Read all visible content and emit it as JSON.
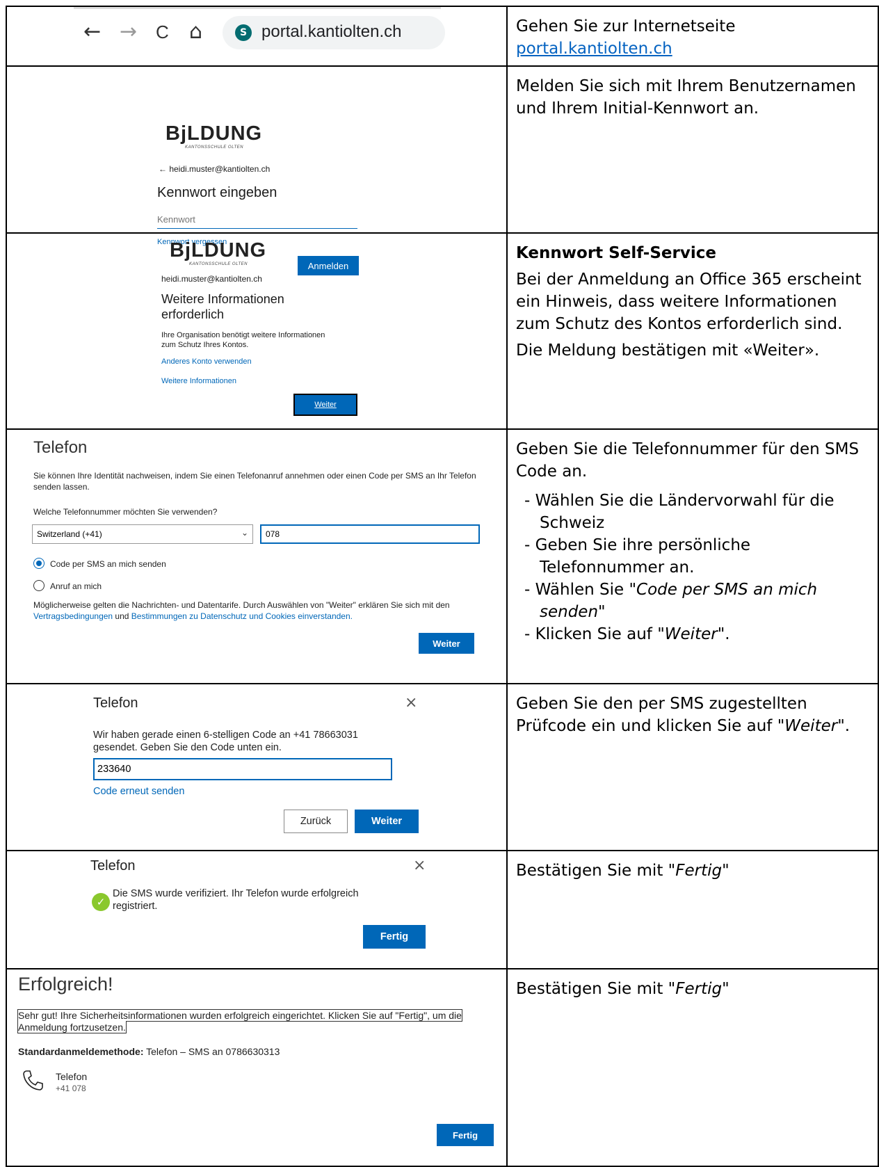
{
  "browser": {
    "back": "←",
    "forward": "→",
    "reload": "C",
    "home": "⌂",
    "site_icon": "S",
    "url": "portal.kantiolten.ch"
  },
  "instructions": {
    "step1": {
      "text": "Gehen Sie zur Internetseite",
      "link": "portal.kantiolten.ch"
    },
    "step2": "Melden Sie sich mit Ihrem Benutzernamen und Ihrem Initial-Kennwort an.",
    "step3": {
      "heading": "Kennwort Self-Service",
      "p1": "Bei der Anmeldung an Office 365 erscheint ein Hinweis, dass weitere Informationen zum Schutz des Kontos erforderlich sind.",
      "p2": "Die Meldung bestätigen mit «Weiter»."
    },
    "step4": {
      "intro": "Geben Sie die Telefonnummer für den SMS Code an.",
      "b1": "Wählen Sie die Ländervorwahl für die Schweiz",
      "b2": "Geben Sie ihre persönliche Telefonnummer an.",
      "b3_pre": "Wählen Sie \"",
      "b3_em": "Code per SMS an mich senden",
      "b3_post": "\"",
      "b4_pre": "Klicken Sie auf \"",
      "b4_em": "Weiter",
      "b4_post": "\"."
    },
    "step5": {
      "pre": "Geben Sie den per SMS zugestellten Prüfcode ein und klicken Sie auf ",
      "q1": "\"",
      "em": "Weiter",
      "post": "\"."
    },
    "step6": {
      "pre": "Bestätigen Sie mit \"",
      "em": "Fertig",
      "post": "\""
    },
    "step7": {
      "pre": "Bestätigen Sie mit \"",
      "em": "Fertig",
      "post": "\""
    }
  },
  "login": {
    "logo": "BjLDUNG",
    "logo_sub": "KANTONSSCHULE OLTEN",
    "back_email": "← heidi.muster@kantiolten.ch",
    "title": "Kennwort eingeben",
    "password_placeholder": "Kennwort",
    "forgot": "Kennwort vergessen",
    "signin": "Anmelden"
  },
  "more_info": {
    "logo": "BjLDUNG",
    "logo_sub": "KANTONSSCHULE OLTEN",
    "email": "heidi.muster@kantiolten.ch",
    "title_l1": "Weitere Informationen",
    "title_l2": "erforderlich",
    "desc_l1": "Ihre Organisation benötigt weitere Informationen",
    "desc_l2": "zum Schutz Ihres Kontos.",
    "other_account": "Anderes Konto verwenden",
    "more_link": "Weitere Informationen",
    "next": "Weiter"
  },
  "phone_setup": {
    "title": "Telefon",
    "desc": "Sie können Ihre Identität nachweisen, indem Sie einen Telefonanruf annehmen oder einen Code per SMS an Ihr Telefon senden lassen.",
    "question": "Welche Telefonnummer möchten Sie verwenden?",
    "country": "Switzerland (+41)",
    "phone_value": "078",
    "opt_sms": "Code per SMS an mich senden",
    "opt_call": "Anruf an mich",
    "terms_pre": "Möglicherweise gelten die Nachrichten- und Datentarife. Durch Auswählen von \"Weiter\" erklären Sie sich mit den ",
    "terms_link1": "Vertragsbedingungen",
    "terms_mid": " und ",
    "terms_link2": "Bestimmungen zu Datenschutz und Cookies einverstanden.",
    "next": "Weiter"
  },
  "code_dialog": {
    "title": "Telefon",
    "close": "×",
    "msg_l1": "Wir haben gerade einen 6-stelligen Code an +41 78663031",
    "msg_l2": "gesendet. Geben Sie den Code unten ein.",
    "code_value": "233640",
    "resend": "Code erneut senden",
    "back": "Zurück",
    "next": "Weiter"
  },
  "verified_dialog": {
    "title": "Telefon",
    "close": "×",
    "check": "✓",
    "msg_l1": "Die SMS wurde verifiziert. Ihr Telefon wurde erfolgreich",
    "msg_l2": "registriert.",
    "done": "Fertig"
  },
  "success": {
    "title": "Erfolgreich!",
    "msg": "Sehr gut! Ihre Sicherheitsinformationen wurden erfolgreich eingerichtet. Klicken Sie auf \"Fertig\", um die Anmeldung fortzusetzen.",
    "method_label": "Standardanmeldemethode:",
    "method_value": " Telefon – SMS an 0786630313",
    "phone_label": "Telefon",
    "phone_number": "+41 078",
    "done": "Fertig"
  }
}
